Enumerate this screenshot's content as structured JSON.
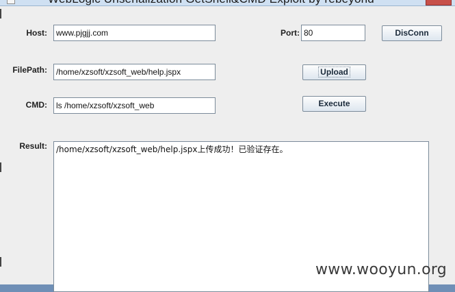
{
  "window": {
    "title": "WebLogic Unserialization GetShell&CMD Exploit       by rebeyond",
    "close_symbol": "✕"
  },
  "form": {
    "host_label": "Host:",
    "host_value": "www.pjgjj.com",
    "port_label": "Port:",
    "port_value": "80",
    "disconn_label": "DisConn",
    "filepath_label": "FilePath:",
    "filepath_value": "/home/xzsoft/xzsoft_web/help.jspx",
    "upload_label": "Upload",
    "cmd_label": "CMD:",
    "cmd_value": "ls /home/xzsoft/xzsoft_web",
    "execute_label": "Execute",
    "result_label": "Result:",
    "result_text": "/home/xzsoft/xzsoft_web/help.jspx上传成功！已验证存在。"
  },
  "watermark": "www.wooyun.org"
}
